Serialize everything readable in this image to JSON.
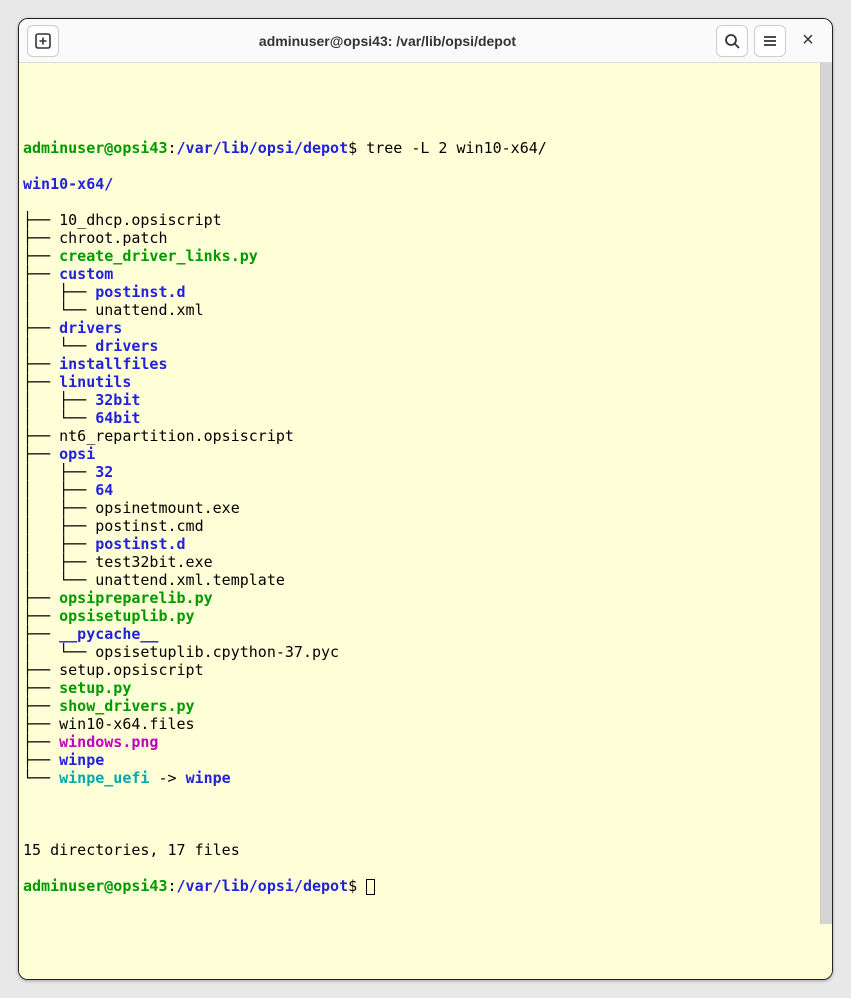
{
  "titlebar": {
    "title": "adminuser@opsi43: /var/lib/opsi/depot",
    "newtab_icon": "plus-in-square",
    "search_icon": "magnifier",
    "menu_icon": "hamburger",
    "close_icon": "close"
  },
  "prompt": {
    "user_host": "adminuser@opsi43",
    "colon": ":",
    "cwd": "/var/lib/opsi/depot",
    "dollar": "$ ",
    "command": "tree -L 2 win10-x64/"
  },
  "tree": {
    "root": "win10-x64/",
    "lines": [
      {
        "prefix": "├── ",
        "indent": 0,
        "name": "10_dhcp.opsiscript",
        "cls": "cmd"
      },
      {
        "prefix": "├── ",
        "indent": 0,
        "name": "chroot.patch",
        "cls": "cmd"
      },
      {
        "prefix": "├── ",
        "indent": 0,
        "name": "create_driver_links.py",
        "cls": "exe"
      },
      {
        "prefix": "├── ",
        "indent": 0,
        "name": "custom",
        "cls": "dir"
      },
      {
        "prefix": "│   ├── ",
        "indent": 1,
        "name": "postinst.d",
        "cls": "dir"
      },
      {
        "prefix": "│   └── ",
        "indent": 1,
        "name": "unattend.xml",
        "cls": "cmd"
      },
      {
        "prefix": "├── ",
        "indent": 0,
        "name": "drivers",
        "cls": "dir"
      },
      {
        "prefix": "│   └── ",
        "indent": 1,
        "name": "drivers",
        "cls": "dir"
      },
      {
        "prefix": "├── ",
        "indent": 0,
        "name": "installfiles",
        "cls": "dir"
      },
      {
        "prefix": "├── ",
        "indent": 0,
        "name": "linutils",
        "cls": "dir"
      },
      {
        "prefix": "│   ├── ",
        "indent": 1,
        "name": "32bit",
        "cls": "dir"
      },
      {
        "prefix": "│   └── ",
        "indent": 1,
        "name": "64bit",
        "cls": "dir"
      },
      {
        "prefix": "├── ",
        "indent": 0,
        "name": "nt6_repartition.opsiscript",
        "cls": "cmd"
      },
      {
        "prefix": "├── ",
        "indent": 0,
        "name": "opsi",
        "cls": "dir"
      },
      {
        "prefix": "│   ├── ",
        "indent": 1,
        "name": "32",
        "cls": "dir"
      },
      {
        "prefix": "│   ├── ",
        "indent": 1,
        "name": "64",
        "cls": "dir"
      },
      {
        "prefix": "│   ├── ",
        "indent": 1,
        "name": "opsinetmount.exe",
        "cls": "cmd"
      },
      {
        "prefix": "│   ├── ",
        "indent": 1,
        "name": "postinst.cmd",
        "cls": "cmd"
      },
      {
        "prefix": "│   ├── ",
        "indent": 1,
        "name": "postinst.d",
        "cls": "dir"
      },
      {
        "prefix": "│   ├── ",
        "indent": 1,
        "name": "test32bit.exe",
        "cls": "cmd"
      },
      {
        "prefix": "│   └── ",
        "indent": 1,
        "name": "unattend.xml.template",
        "cls": "cmd"
      },
      {
        "prefix": "├── ",
        "indent": 0,
        "name": "opsipreparelib.py",
        "cls": "exe"
      },
      {
        "prefix": "├── ",
        "indent": 0,
        "name": "opsisetuplib.py",
        "cls": "exe"
      },
      {
        "prefix": "├── ",
        "indent": 0,
        "name": "__pycache__",
        "cls": "dir"
      },
      {
        "prefix": "│   └── ",
        "indent": 1,
        "name": "opsisetuplib.cpython-37.pyc",
        "cls": "cmd"
      },
      {
        "prefix": "├── ",
        "indent": 0,
        "name": "setup.opsiscript",
        "cls": "cmd"
      },
      {
        "prefix": "├── ",
        "indent": 0,
        "name": "setup.py",
        "cls": "exe"
      },
      {
        "prefix": "├── ",
        "indent": 0,
        "name": "show_drivers.py",
        "cls": "exe"
      },
      {
        "prefix": "├── ",
        "indent": 0,
        "name": "win10-x64.files",
        "cls": "cmd"
      },
      {
        "prefix": "├── ",
        "indent": 0,
        "name": "windows.png",
        "cls": "img"
      },
      {
        "prefix": "├── ",
        "indent": 0,
        "name": "winpe",
        "cls": "dir"
      },
      {
        "prefix": "└── ",
        "indent": 0,
        "name": "winpe_uefi",
        "cls": "lnk",
        "arrow": " -> ",
        "target": "winpe",
        "target_cls": "dir"
      }
    ],
    "summary": "15 directories, 17 files"
  },
  "prompt2": {
    "user_host": "adminuser@opsi43",
    "colon": ":",
    "cwd": "/var/lib/opsi/depot",
    "dollar": "$ "
  }
}
